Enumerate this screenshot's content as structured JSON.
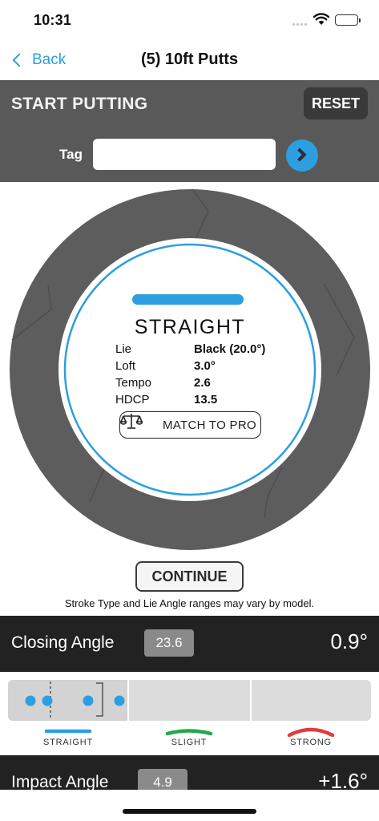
{
  "status_bar": {
    "time": "10:31"
  },
  "nav": {
    "back_label": "Back",
    "title": "(5) 10ft Putts"
  },
  "header": {
    "title": "START PUTTING",
    "reset_label": "RESET",
    "tag_label": "Tag",
    "tag_value": ""
  },
  "result": {
    "stroke_type": "STRAIGHT",
    "stroke_color": "#2b9fe0",
    "stats": [
      {
        "label": "Lie",
        "value": "Black (20.0°)"
      },
      {
        "label": "Loft",
        "value": "3.0°"
      },
      {
        "label": "Tempo",
        "value": "2.6"
      },
      {
        "label": "HDCP",
        "value": "13.5"
      }
    ],
    "match_label": "MATCH TO PRO",
    "match_icon": "scale-icon"
  },
  "continue_label": "CONTINUE",
  "disclaimer": "Stroke Type and Lie Angle ranges may vary by model.",
  "closing_angle": {
    "label": "Closing Angle",
    "score": "23.6",
    "value": "0.9°"
  },
  "impact_angle": {
    "label": "Impact Angle",
    "score": "4.9",
    "value": "+1.6°"
  },
  "legend": [
    {
      "label": "STRAIGHT",
      "color": "#2b9fe0"
    },
    {
      "label": "SLIGHT",
      "color": "#22a84a"
    },
    {
      "label": "STRONG",
      "color": "#e23b3b"
    }
  ]
}
